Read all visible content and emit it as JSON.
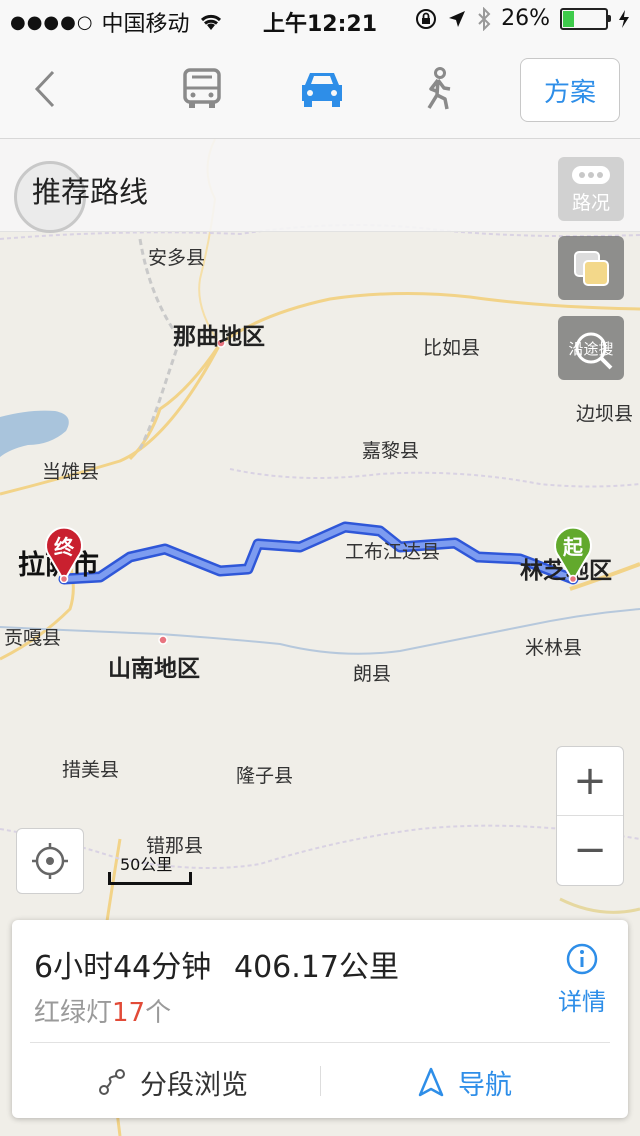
{
  "status_bar": {
    "carrier": "中国移动",
    "time": "上午12:21",
    "battery": "26%",
    "battery_level": 0.26
  },
  "navbar": {
    "back_icon": "chevron-left-icon",
    "modes": [
      "bus-icon",
      "car-icon",
      "walk-icon"
    ],
    "selected_mode": "car",
    "plan_label": "方案",
    "accent": "#2e8ee8"
  },
  "map": {
    "route_title": "推荐路线",
    "traffic_label": "路况",
    "along_search_label": "沿途搜",
    "scale_label": "50公里",
    "zoom_in": "+",
    "zoom_out": "−",
    "start_marker": "起",
    "end_marker": "终",
    "places": {
      "anduo": "安多县",
      "naqu": "那曲地区",
      "biru": "比如县",
      "bianba": "边坝县",
      "jiali": "嘉黎县",
      "dangxiong": "当雄县",
      "lhasa": "拉萨市",
      "gongbu": "工布江达县",
      "linzhi": "林芝地区",
      "gongga": "贡嘎县",
      "shannan": "山南地区",
      "lang": "朗县",
      "milin": "米林县",
      "cuomei": "措美县",
      "longzi": "隆子县",
      "cuona": "错那县"
    }
  },
  "summary": {
    "duration": "6小时44分钟",
    "distance": "406.17公里",
    "lights_prefix": "红绿灯",
    "lights_count": "17",
    "lights_suffix": "个",
    "details_label": "详情",
    "segment_label": "分段浏览",
    "navigate_label": "导航"
  }
}
